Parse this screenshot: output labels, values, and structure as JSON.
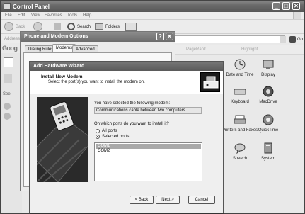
{
  "control_panel": {
    "title": "Control Panel",
    "menu": [
      "File",
      "Edit",
      "View",
      "Favorites",
      "Tools",
      "Help"
    ],
    "toolbar": {
      "back": "Back",
      "search": "Search",
      "folders": "Folders"
    },
    "address_label": "Address",
    "go": "Go",
    "google_label": "Goog",
    "google_strip": [
      "PageRank",
      "Highlight"
    ],
    "see_label": "See",
    "icons": [
      {
        "name": "date-and-time",
        "label": "Date and Time"
      },
      {
        "name": "display",
        "label": "Display"
      },
      {
        "name": "keyboard",
        "label": "Keyboard"
      },
      {
        "name": "macdrive",
        "label": "MacDrive"
      },
      {
        "name": "printers-and-faxes",
        "label": "Printers and Faxes"
      },
      {
        "name": "quicktime",
        "label": "QuickTime"
      },
      {
        "name": "speech",
        "label": "Speech"
      },
      {
        "name": "system",
        "label": "System"
      }
    ]
  },
  "phone_modem": {
    "title": "Phone and Modem Options",
    "tabs": [
      "Dialing Rules",
      "Modems",
      "Advanced"
    ],
    "active_tab": "Modems"
  },
  "wizard": {
    "title": "Add Hardware Wizard",
    "header_title": "Install New Modem",
    "header_sub": "Select the port(s) you want to install the modem on.",
    "selected_label": "You have selected the following modem:",
    "selected_modem": "Communications cable between two computers",
    "ports_question": "On which ports do you want to install it?",
    "radio_all": "All ports",
    "radio_selected": "Selected ports",
    "ports": [
      "COM1",
      "COM2"
    ],
    "selected_port": "COM1",
    "buttons": {
      "back": "< Back",
      "next": "Next >",
      "cancel": "Cancel"
    }
  },
  "colors": {
    "titlebar": "#6a6a6a",
    "selection": "#a9a9a9",
    "background": "#e9e9e9"
  }
}
